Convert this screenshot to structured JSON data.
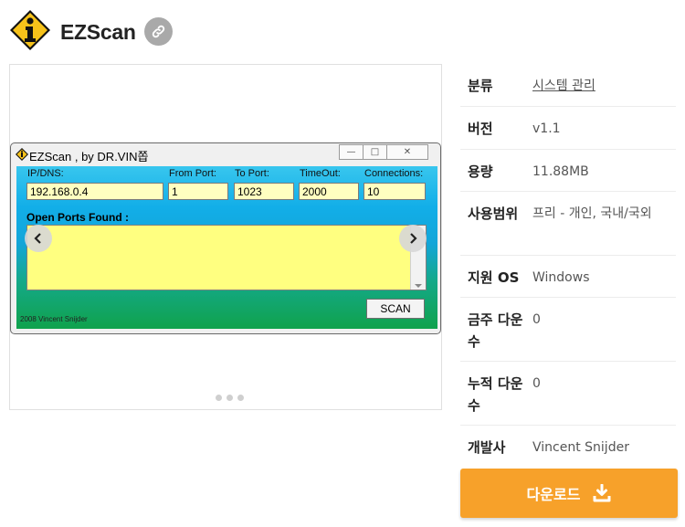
{
  "header": {
    "app_name": "EZScan",
    "icon": "info-warning-sign-icon",
    "link_icon": "link-icon"
  },
  "screenshot": {
    "window_title": "EZScan , by DR.VIN쫍",
    "labels": {
      "ip": "IP/DNS:",
      "from_port": "From Port:",
      "to_port": "To Port:",
      "timeout": "TimeOut:",
      "connections": "Connections:"
    },
    "values": {
      "ip": "192.168.0.4",
      "from_port": "1",
      "to_port": "1023",
      "timeout": "2000",
      "connections": "10"
    },
    "open_ports_label": "Open Ports Found :",
    "scan_label": "SCAN",
    "copyright": "2008 Vincent Snijder"
  },
  "gallery": {
    "dots": 3,
    "prev_icon": "chevron-left-icon",
    "next_icon": "chevron-right-icon"
  },
  "info": [
    {
      "key": "분류",
      "value": "시스템 관리"
    },
    {
      "key": "버전",
      "value": "v1.1"
    },
    {
      "key": "용량",
      "value": "11.88MB"
    },
    {
      "key": "사용범위",
      "value": "프리 - 개인, 국내/국외"
    },
    {
      "key": "지원 OS",
      "value": "Windows"
    },
    {
      "key": "금주 다운수",
      "value": "0"
    },
    {
      "key": "누적 다운수",
      "value": "0"
    },
    {
      "key": "개발사",
      "value": "Vincent Snijder"
    }
  ],
  "download": {
    "label": "다운로드",
    "icon": "download-icon"
  },
  "colors": {
    "accent": "#f7a12a",
    "link_button": "#a9a9a9",
    "field_bg": "#ffffc0",
    "ports_bg": "#ffff80"
  }
}
